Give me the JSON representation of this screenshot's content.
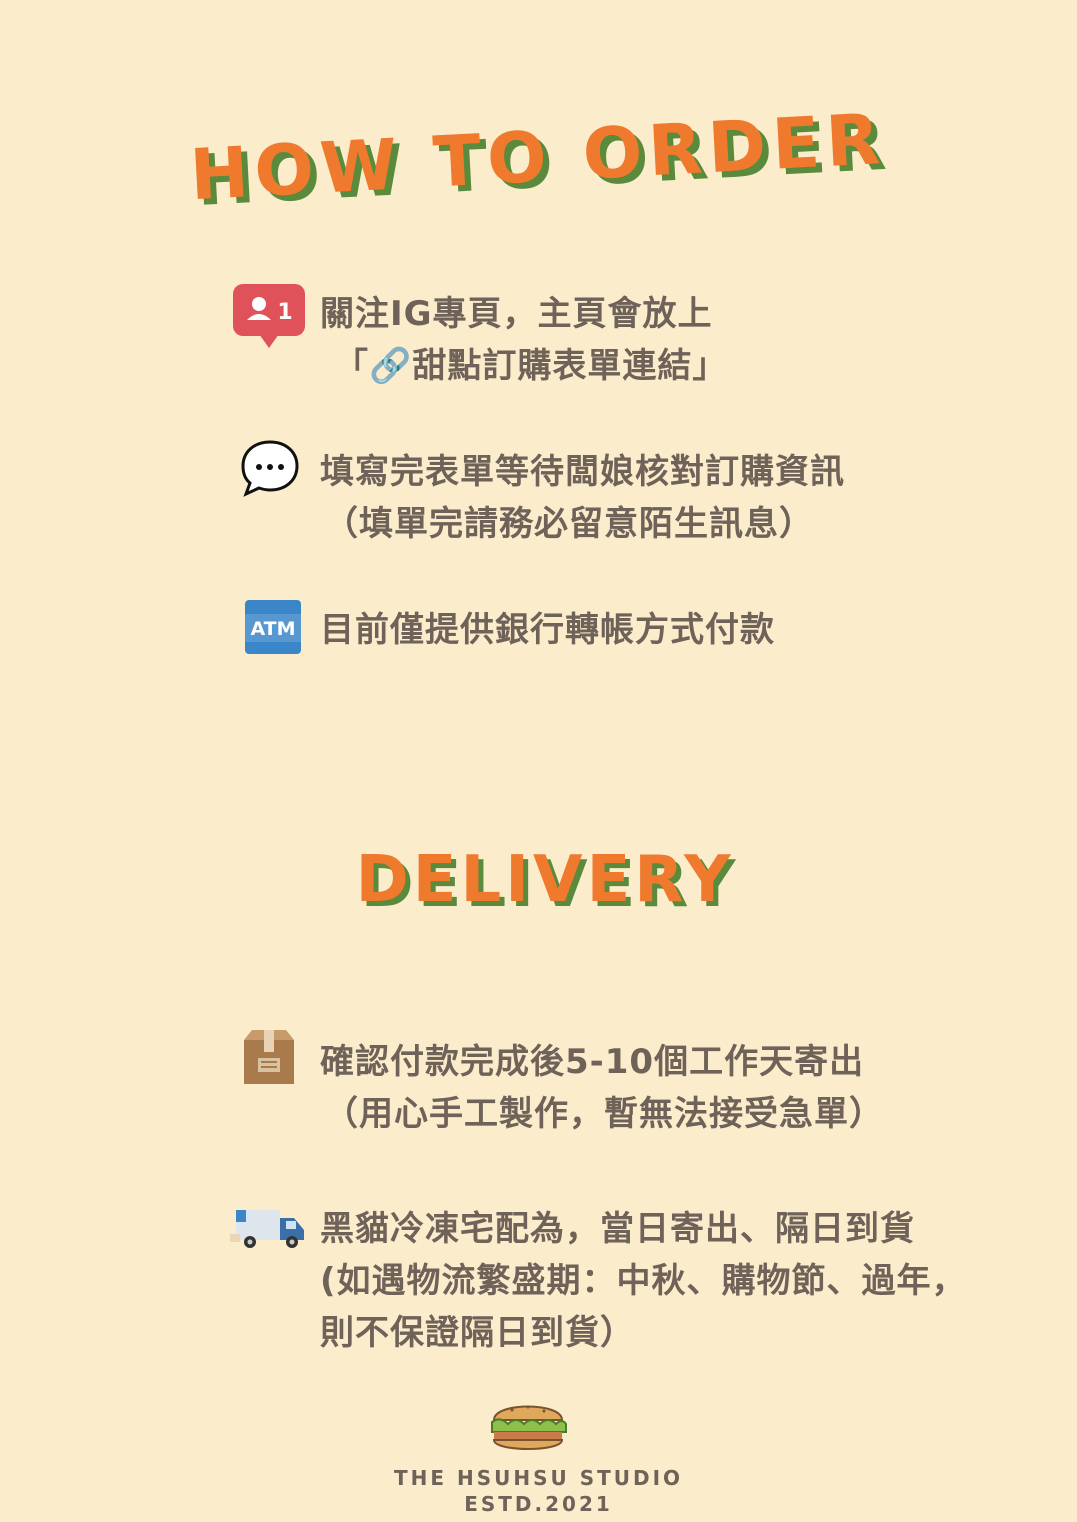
{
  "order": {
    "heading": "HOW TO ORDER",
    "steps": [
      {
        "icon": "follower-notification-icon",
        "badge": "1",
        "line1": "關注IG專頁，主頁會放上",
        "line2": "「🔗甜點訂購表單連結」"
      },
      {
        "icon": "chat-bubble-icon",
        "line1": "填寫完表單等待闆娘核對訂購資訊",
        "line2": "（填單完請務必留意陌生訊息）"
      },
      {
        "icon": "atm-icon",
        "badge": "ATM",
        "line1": "目前僅提供銀行轉帳方式付款"
      }
    ]
  },
  "delivery": {
    "heading": "DELIVERY",
    "steps": [
      {
        "icon": "package-box-icon",
        "line1": "確認付款完成後5-10個工作天寄出",
        "line2": "（用心手工製作，暫無法接受急單）"
      },
      {
        "icon": "delivery-truck-icon",
        "line1": "黑貓冷凍宅配為，當日寄出、隔日到貨",
        "line2": "(如遇物流繁盛期：中秋、購物節、過年，",
        "line3": "則不保證隔日到貨）"
      }
    ]
  },
  "footer": {
    "logo_icon": "sandwich-icon",
    "studio": "THE HSUHSU STUDIO",
    "established": "ESTD.2021"
  },
  "colors": {
    "background": "#fbeccc",
    "heading_orange": "#ef7a2e",
    "heading_green": "#5a8a3c",
    "text": "#6e6259",
    "badge_red": "#e0525a",
    "atm_blue": "#3a86c8"
  }
}
